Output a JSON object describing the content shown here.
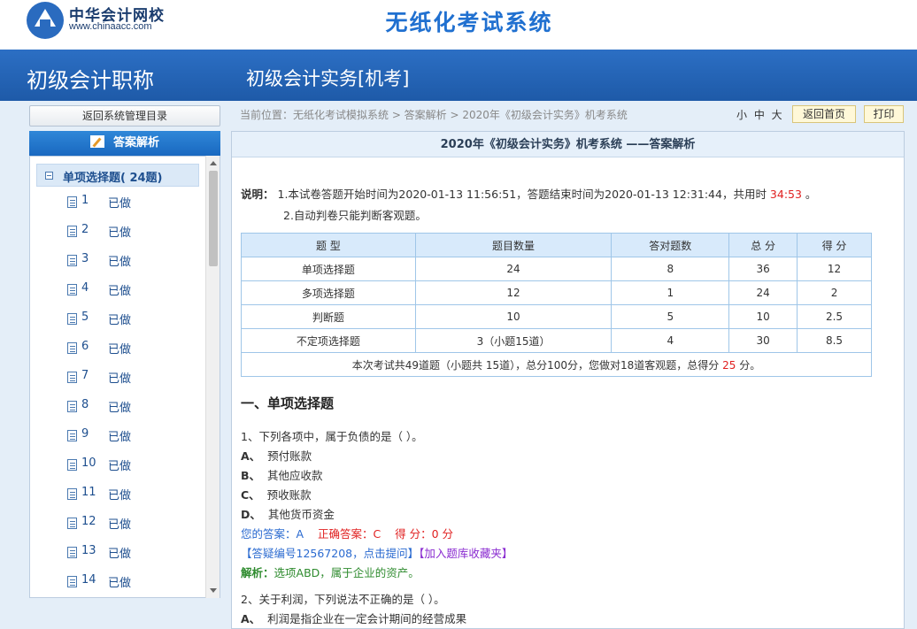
{
  "header": {
    "logo_cn": "中华会计网校",
    "logo_en": "www.chinaacc.com",
    "system_title": "无纸化考试系统"
  },
  "banner": {
    "category": "初级会计职称",
    "subject": "初级会计实务[机考]"
  },
  "sidebar": {
    "back_label": "返回系统管理目录",
    "panel_title": "答案解析",
    "group_label": "单项选择题( 24题)",
    "items": [
      {
        "num": "1",
        "status": "已做"
      },
      {
        "num": "2",
        "status": "已做"
      },
      {
        "num": "3",
        "status": "已做"
      },
      {
        "num": "4",
        "status": "已做"
      },
      {
        "num": "5",
        "status": "已做"
      },
      {
        "num": "6",
        "status": "已做"
      },
      {
        "num": "7",
        "status": "已做"
      },
      {
        "num": "8",
        "status": "已做"
      },
      {
        "num": "9",
        "status": "已做"
      },
      {
        "num": "10",
        "status": "已做"
      },
      {
        "num": "11",
        "status": "已做"
      },
      {
        "num": "12",
        "status": "已做"
      },
      {
        "num": "13",
        "status": "已做"
      },
      {
        "num": "14",
        "status": "已做"
      }
    ]
  },
  "toolbar": {
    "breadcrumb": "当前位置：无纸化考试模拟系统 > 答案解析 > 2020年《初级会计实务》机考系统",
    "font_sizes": "小 中 大",
    "home_label": "返回首页",
    "print_label": "打印"
  },
  "content": {
    "title": "2020年《初级会计实务》机考系统 ——答案解析",
    "note_label": "说明：",
    "note_line1_prefix": "1.本试卷答题开始时间为2020-01-13 11:56:51，答题结束时间为2020-01-13 12:31:44，共用时 ",
    "note_line1_time": "34:53",
    "note_line1_suffix": " 。",
    "note_line2": "2.自动判卷只能判断客观题。",
    "table": {
      "headers": [
        "题 型",
        "题目数量",
        "答对题数",
        "总 分",
        "得 分"
      ],
      "rows": [
        [
          "单项选择题",
          "24",
          "8",
          "36",
          "12"
        ],
        [
          "多项选择题",
          "12",
          "1",
          "24",
          "2"
        ],
        [
          "判断题",
          "10",
          "5",
          "10",
          "2.5"
        ],
        [
          "不定项选择题",
          "3（小题15道）",
          "4",
          "30",
          "8.5"
        ]
      ],
      "summary_prefix": "本次考试共49道题（小题共 15道），总分100分，您做对18道客观题，总得分 ",
      "summary_score": "25",
      "summary_suffix": " 分。"
    },
    "section_title": "一、单项选择题",
    "q1": {
      "stem": "1、下列各项中，属于负债的是（     ）。",
      "options": [
        {
          "letter": "A、",
          "text": "预付账款"
        },
        {
          "letter": "B、",
          "text": "其他应收款"
        },
        {
          "letter": "C、",
          "text": "预收账款"
        },
        {
          "letter": "D、",
          "text": "其他货币资金"
        }
      ],
      "your_answer": "您的答案：A",
      "correct_answer": "正确答案：C",
      "score": "得 分：0 分",
      "qa_link": "【答疑编号12567208，点击提问】",
      "fav_link": "【加入题库收藏夹】",
      "analysis_label": "解析：",
      "analysis_text": "选项ABD，属于企业的资产。"
    },
    "q2": {
      "stem": "2、关于利润，下列说法不正确的是（     ）。",
      "option_a_letter": "A、",
      "option_a_text": "利润是指企业在一定会计期间的经营成果"
    }
  }
}
